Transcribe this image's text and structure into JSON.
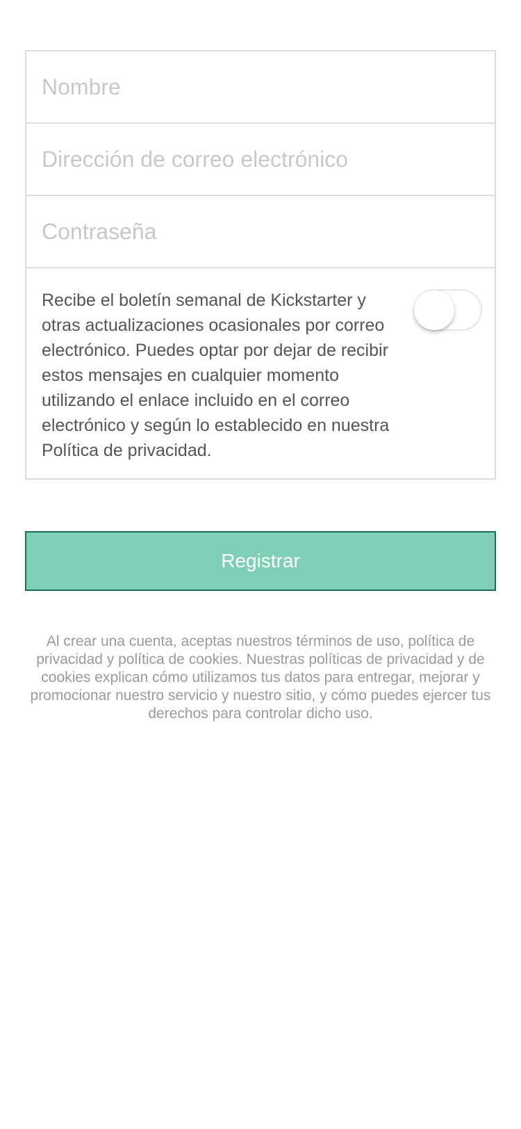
{
  "form": {
    "name_placeholder": "Nombre",
    "email_placeholder": "Dirección de correo electrónico",
    "password_placeholder": "Contraseña",
    "newsletter_text": "Recibe el boletín semanal de Kickstarter y otras actualizaciones ocasionales por correo electrónico. Puedes optar por dejar de recibir estos mensajes en cualquier momento utilizando el enlace incluido en el correo electrónico y según lo establecido en nuestra Política de privacidad.",
    "newsletter_toggle_on": false
  },
  "register_button_label": "Registrar",
  "legal_text": "Al crear una cuenta, aceptas nuestros términos de uso, política de privacidad y política de cookies. Nuestras políticas de privacidad y de cookies explican cómo utilizamos tus datos para entregar, mejorar y promocionar nuestro servicio y nuestro sitio, y cómo puedes ejercer tus derechos para controlar dicho uso.",
  "colors": {
    "button_background": "#7fcfb6",
    "button_border": "#1b6b55",
    "placeholder": "#c8c8cc",
    "border": "#dcdcdc"
  }
}
